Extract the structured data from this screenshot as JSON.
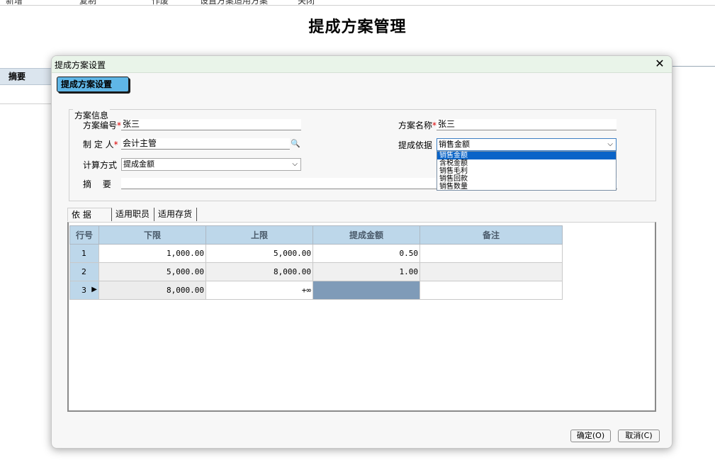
{
  "page": {
    "title": "提成方案管理"
  },
  "topmenu": [
    "新增",
    "复制",
    "作废",
    "设置方案适用方案",
    "关闭"
  ],
  "background": {
    "summary_header": "摘要"
  },
  "dialog": {
    "title": "提成方案设置",
    "header_button": "提成方案设置",
    "group_label": "方案信息",
    "fields": {
      "code_label": "方案编号",
      "code_value": "张三",
      "name_label": "方案名称",
      "name_value": "张三",
      "maker_label": "制 定 人",
      "maker_value": "会计主管",
      "basis_label": "提成依据",
      "basis_value": "销售金额",
      "calc_label": "计算方式",
      "calc_value": "提成金额",
      "summary_label": "摘　 要",
      "summary_value": "",
      "required_mark": "*"
    },
    "basis_options": [
      "销售金额",
      "含税金额",
      "销售毛利",
      "销售回款",
      "销售数量"
    ],
    "tabs": [
      "依  据",
      "适用职员",
      "适用存货"
    ],
    "grid": {
      "headers": [
        "行号",
        "下限",
        "上限",
        "提成金额",
        "备注"
      ],
      "rows": [
        {
          "no": "1",
          "low": "1,000.00",
          "high": "5,000.00",
          "amount": "0.50",
          "note": ""
        },
        {
          "no": "2",
          "low": "5,000.00",
          "high": "8,000.00",
          "amount": "1.00",
          "note": ""
        },
        {
          "no": "3",
          "low": "8,000.00",
          "high": "+∞",
          "amount": "",
          "note": ""
        }
      ]
    },
    "buttons": {
      "ok": "确定(O)",
      "cancel": "取消(C)"
    }
  }
}
